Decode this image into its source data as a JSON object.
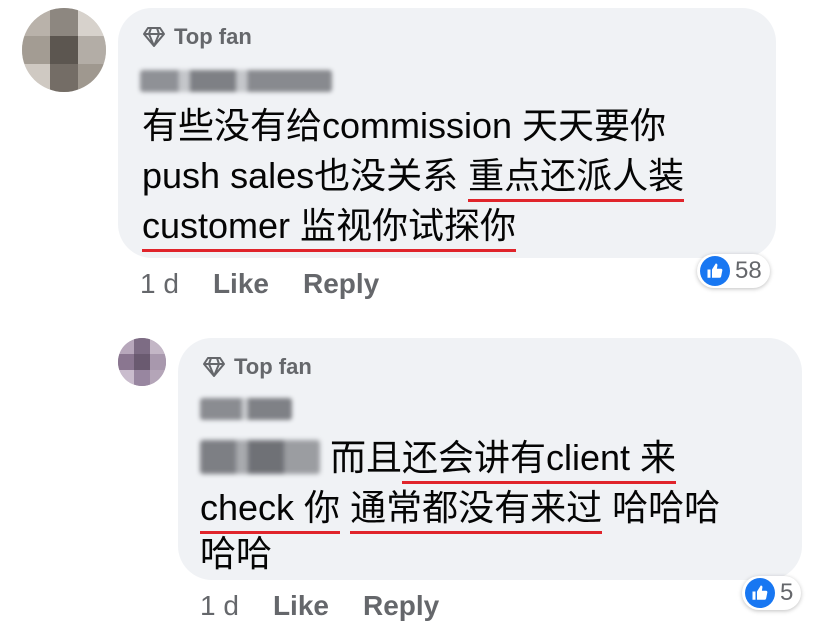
{
  "comments": [
    {
      "badge": "Top fan",
      "lines": [
        [
          "有些没有给commission 天天要你"
        ],
        [
          "push sales也没关系 ",
          "重点还派人装"
        ],
        [
          "customer 监视你试探你"
        ]
      ],
      "age": "1 d",
      "like_label": "Like",
      "reply_label": "Reply",
      "reactions": "58"
    },
    {
      "badge": "Top fan",
      "line1_text": " 而且",
      "line1_underlined": "还会讲有client 来",
      "line2_underlined_a": "check 你",
      "line2_underlined_b": "通常都没有来过",
      "line2_tail": " 哈哈哈",
      "line3": "哈哈",
      "age": "1 d",
      "like_label": "Like",
      "reply_label": "Reply",
      "reactions": "5"
    }
  ],
  "colors": {
    "bubble": "#f0f2f5",
    "underline": "#e0242b",
    "like_blue": "#1877f2",
    "meta": "#65676b"
  }
}
